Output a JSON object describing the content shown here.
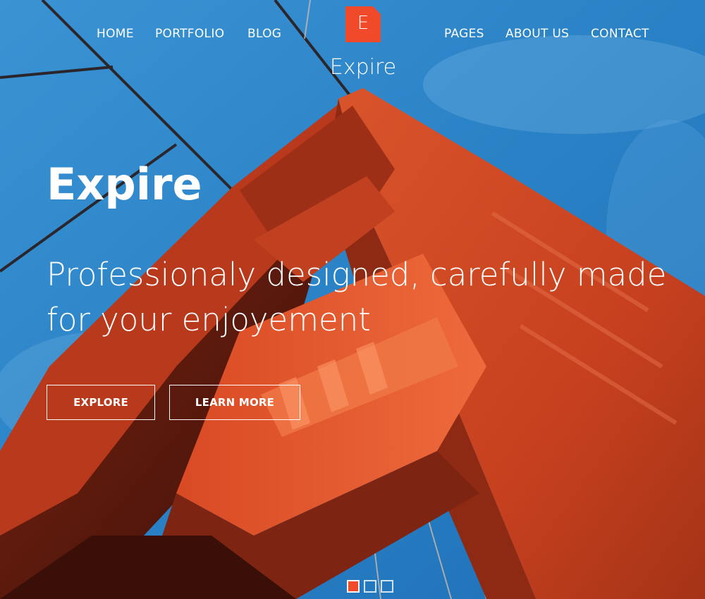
{
  "nav": {
    "left_items": [
      {
        "label": "HOME"
      },
      {
        "label": "PORTFOLIO"
      },
      {
        "label": "BLOG"
      }
    ],
    "right_items": [
      {
        "label": "PAGES"
      },
      {
        "label": "ABOUT US"
      },
      {
        "label": "CONTACT"
      }
    ]
  },
  "logo": {
    "letter": "E",
    "brand_name": "Expire",
    "color": "#f04a2a"
  },
  "hero": {
    "title": "Expire",
    "tagline": "Professionaly designed, carefully made for your enjoyement",
    "buttons": {
      "explore": "EXPLORE",
      "learn_more": "LEARN MORE"
    }
  },
  "slider": {
    "slides": 3,
    "active_index": 0
  },
  "colors": {
    "accent": "#f04a2a",
    "sky": "#2b86c8",
    "bridge": "#c4401f",
    "text": "#ffffff"
  }
}
